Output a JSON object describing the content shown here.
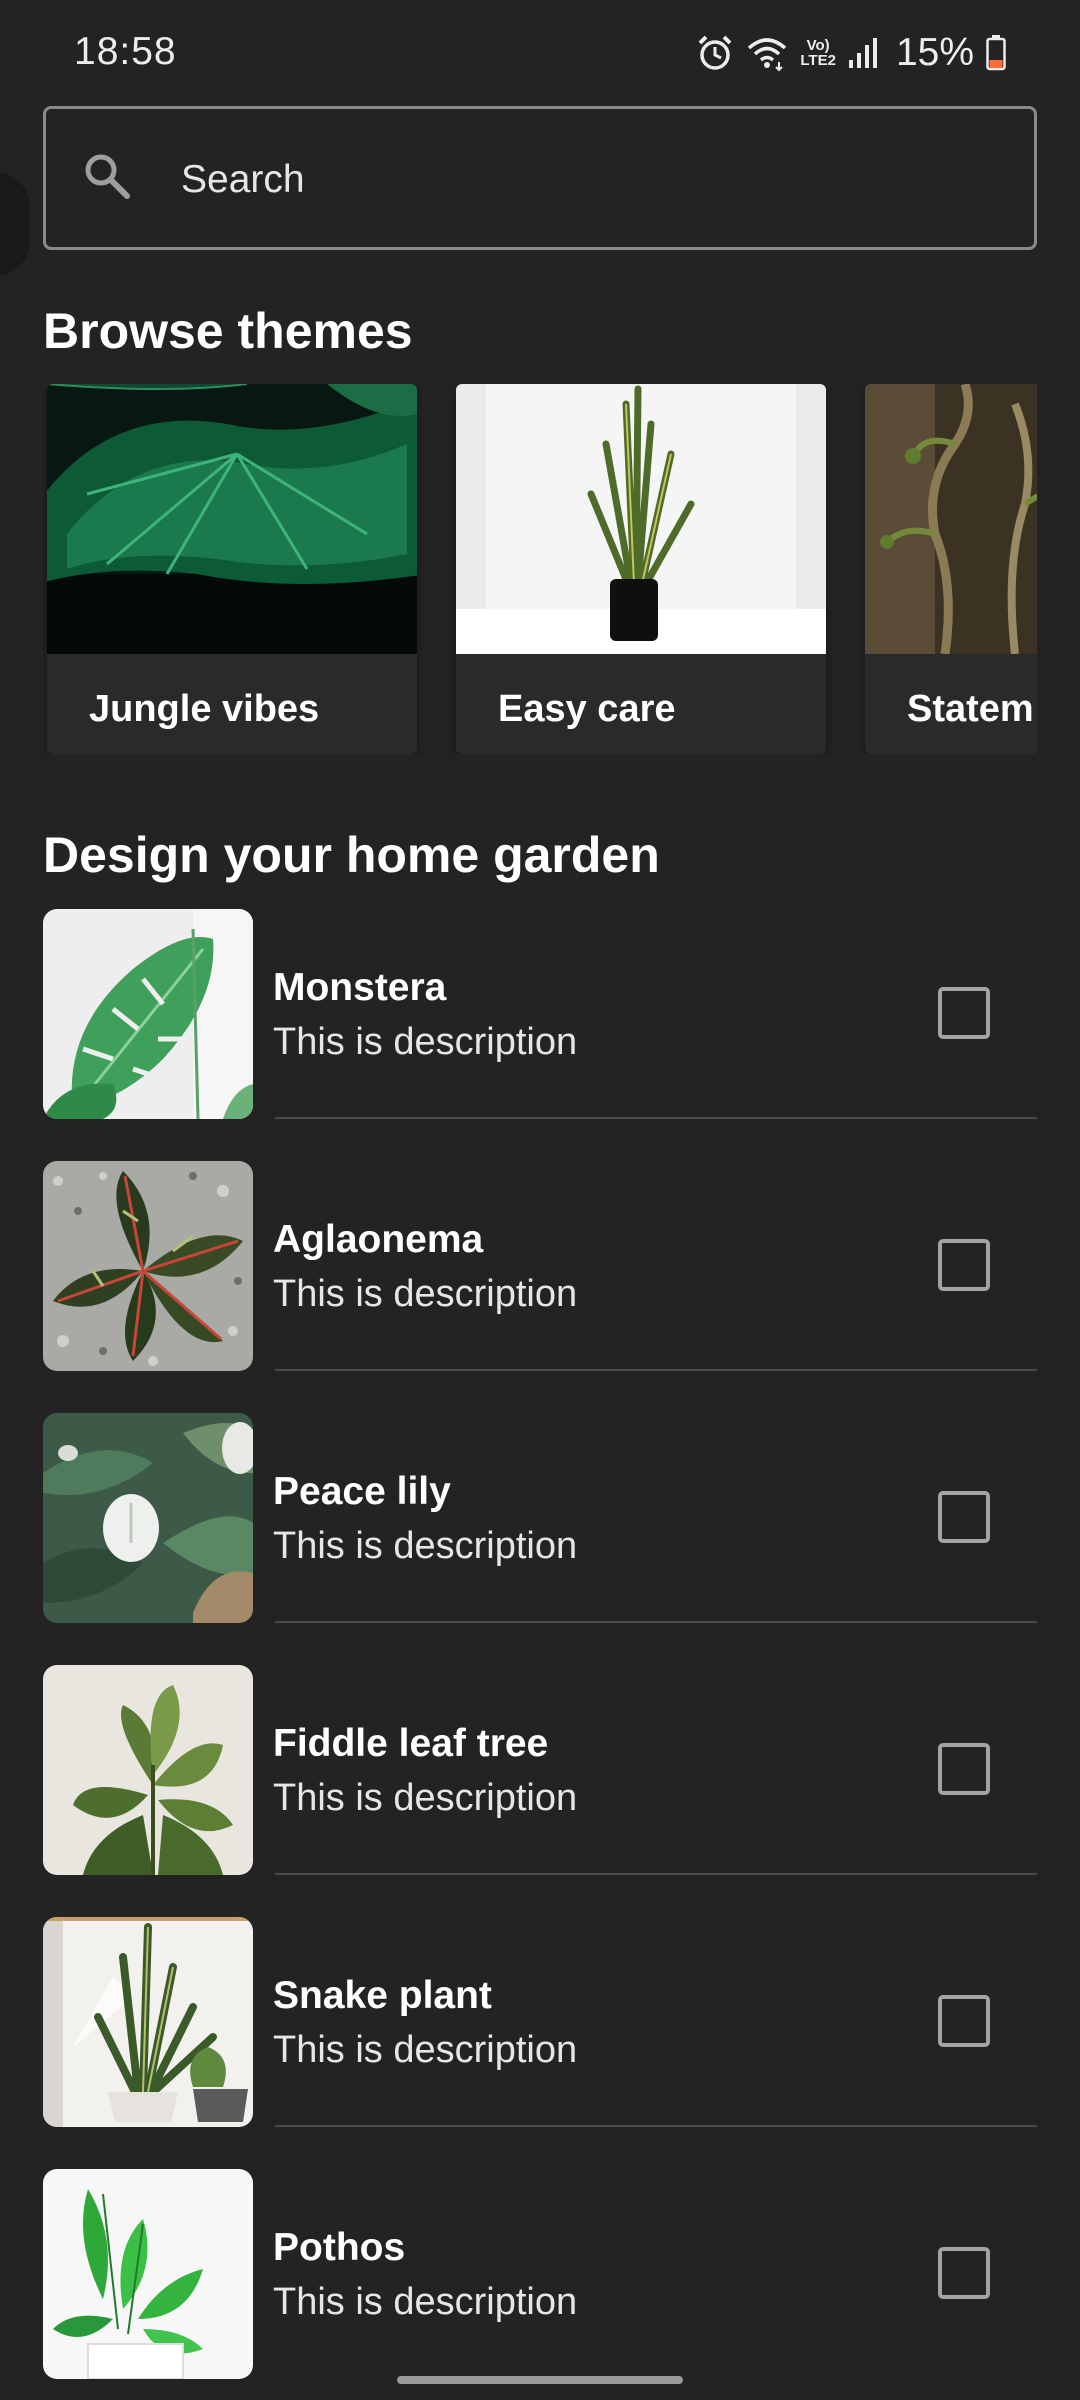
{
  "status_bar": {
    "time": "18:58",
    "battery_percent": "15%",
    "network_label_top": "Vo)",
    "network_label_bottom": "LTE2",
    "icons": [
      "alarm-icon",
      "wifi-icon",
      "volte-icon",
      "signal-icon",
      "battery-icon"
    ],
    "battery_level": 0.15,
    "battery_color": "#ff6a3d"
  },
  "search": {
    "placeholder": "Search"
  },
  "themes": {
    "title": "Browse themes",
    "items": [
      {
        "label": "Jungle vibes"
      },
      {
        "label": "Easy care"
      },
      {
        "label": "Statem"
      }
    ]
  },
  "garden": {
    "title": "Design your home garden",
    "items": [
      {
        "name": "Monstera",
        "description": "This is description",
        "checked": false
      },
      {
        "name": "Aglaonema",
        "description": "This is description",
        "checked": false
      },
      {
        "name": "Peace lily",
        "description": "This is description",
        "checked": false
      },
      {
        "name": "Fiddle leaf tree",
        "description": "This is description",
        "checked": false
      },
      {
        "name": "Snake plant",
        "description": "This is description",
        "checked": false
      },
      {
        "name": "Pothos",
        "description": "This is description",
        "checked": false
      }
    ]
  },
  "colors": {
    "background": "#232323",
    "text": "#ffffff",
    "checkbox_border": "#a3a3a3"
  }
}
